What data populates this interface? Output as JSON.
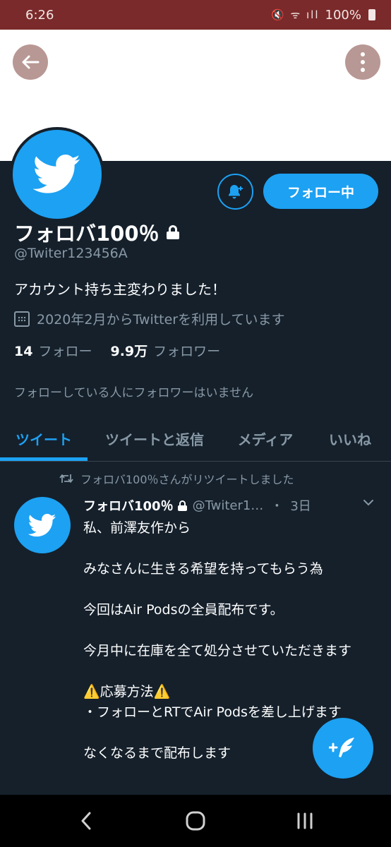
{
  "status_bar": {
    "time": "6:26",
    "icons": "🔇 ᯤ ıll",
    "battery": "100%"
  },
  "profile": {
    "follow_button": "フォロー中",
    "display_name": "フォロバ100％",
    "handle": "@Twiter123456A",
    "bio": "アカウント持ち主変わりました！",
    "joined": "2020年2月からTwitterを利用しています",
    "following_count": "14",
    "following_label": "フォロー",
    "followers_count": "9.9万",
    "followers_label": "フォロワー",
    "known_followers": "フォローしている人にフォロワーはいません"
  },
  "tabs": [
    {
      "label": "ツイート",
      "active": true
    },
    {
      "label": "ツイートと返信",
      "active": false
    },
    {
      "label": "メディア",
      "active": false
    },
    {
      "label": "いいね",
      "active": false
    }
  ],
  "tweet": {
    "retweet_context": "フォロバ100％さんがリツイートしました",
    "name": "フォロバ100％",
    "handle": "@Twiter1…",
    "separator": "・",
    "time": "3日",
    "lines": [
      "私、前澤友作から",
      "みなさんに生きる希望を持ってもらう為",
      "今回はAir Podsの全員配布です。",
      "今月中に在庫を全て処分させていただきます",
      "⚠️応募方法⚠️",
      "・フォローとRTでAir Podsを差し上げます",
      "なくなるまで配布します"
    ]
  },
  "colors": {
    "accent": "#1da1f2",
    "background": "#15202b",
    "status_bar": "#7a2a2a",
    "secondary_text": "#8899a6"
  },
  "icons": [
    "back-arrow-icon",
    "more-vertical-icon",
    "twitter-bird-icon",
    "bell-plus-icon",
    "lock-icon",
    "calendar-icon",
    "retweet-icon",
    "chevron-down-icon",
    "compose-tweet-icon",
    "nav-back-icon",
    "nav-home-icon",
    "nav-recents-icon"
  ]
}
